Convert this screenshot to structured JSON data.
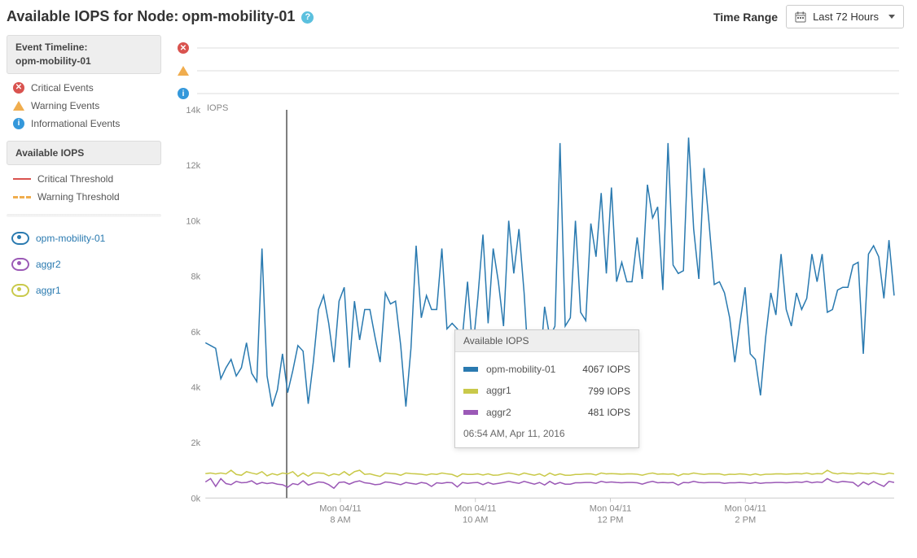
{
  "header": {
    "title_prefix": "Available IOPS for Node:",
    "node_name": "opm-mobility-01",
    "time_range_label": "Time Range",
    "time_range_value": "Last 72 Hours"
  },
  "sidebar": {
    "event_timeline_label": "Event Timeline:",
    "event_timeline_target": "opm-mobility-01",
    "events": {
      "critical": "Critical Events",
      "warning": "Warning Events",
      "info": "Informational Events"
    },
    "iops_header": "Available IOPS",
    "thresholds": {
      "critical": "Critical Threshold",
      "warning": "Warning Threshold"
    },
    "series": [
      {
        "id": "opm-mobility-01",
        "color": "#2a7ab0"
      },
      {
        "id": "aggr2",
        "color": "#9b59b6"
      },
      {
        "id": "aggr1",
        "color": "#c9c94a"
      }
    ]
  },
  "tooltip": {
    "title": "Available IOPS",
    "rows": [
      {
        "name": "opm-mobility-01",
        "value": "4067 IOPS",
        "color": "#2a7ab0"
      },
      {
        "name": "aggr1",
        "value": "799 IOPS",
        "color": "#c9c94a"
      },
      {
        "name": "aggr2",
        "value": "481 IOPS",
        "color": "#9b59b6"
      }
    ],
    "timestamp": "06:54 AM, Apr 11, 2016"
  },
  "chart_data": {
    "type": "line",
    "title": "Available IOPS for Node: opm-mobility-01",
    "ylabel": "IOPS",
    "ylim": [
      0,
      14000
    ],
    "yticks": [
      "0k",
      "2k",
      "4k",
      "6k",
      "8k",
      "10k",
      "12k",
      "14k"
    ],
    "xticks": [
      {
        "top": "Mon 04/11",
        "bottom": "8 AM",
        "frac": 0.196
      },
      {
        "top": "Mon 04/11",
        "bottom": "10 AM",
        "frac": 0.392
      },
      {
        "top": "Mon 04/11",
        "bottom": "12 PM",
        "frac": 0.588
      },
      {
        "top": "Mon 04/11",
        "bottom": "2 PM",
        "frac": 0.784
      }
    ],
    "cursor_frac": 0.118,
    "series": [
      {
        "name": "opm-mobility-01",
        "color": "#2a7ab0",
        "values": [
          5600,
          5500,
          5400,
          4300,
          4700,
          5000,
          4400,
          4700,
          5600,
          4500,
          4200,
          9000,
          4400,
          3300,
          3900,
          5200,
          3800,
          4600,
          5500,
          5300,
          3400,
          4900,
          6800,
          7300,
          6300,
          4900,
          7100,
          7600,
          4700,
          7100,
          5700,
          6800,
          6800,
          5800,
          4900,
          7400,
          7000,
          7100,
          5500,
          3300,
          5400,
          9100,
          6500,
          7300,
          6800,
          6800,
          9000,
          6100,
          6300,
          6100,
          5800,
          7800,
          5300,
          7200,
          9500,
          6300,
          9000,
          7800,
          6200,
          10000,
          8100,
          9700,
          7400,
          4400,
          5800,
          4500,
          6900,
          5800,
          6200,
          12800,
          6200,
          6500,
          10000,
          6700,
          6400,
          9900,
          8700,
          11000,
          8100,
          11200,
          7800,
          8500,
          7800,
          7800,
          9400,
          7900,
          11300,
          10100,
          10500,
          7500,
          12800,
          8400,
          8100,
          8200,
          13000,
          9700,
          7900,
          11900,
          9900,
          7700,
          7800,
          7400,
          6500,
          4900,
          6300,
          7600,
          5200,
          5000,
          3700,
          5800,
          7400,
          6600,
          8800,
          6800,
          6200,
          7400,
          6800,
          7200,
          8800,
          7800,
          8800,
          6700,
          6800,
          7500,
          7600,
          7600,
          8400,
          8500,
          5200,
          8800,
          9100,
          8700,
          7200,
          9300,
          7300
        ]
      },
      {
        "name": "aggr1",
        "color": "#c9c94a",
        "values": [
          880,
          900,
          870,
          900,
          870,
          1000,
          850,
          820,
          950,
          900,
          860,
          950,
          800,
          880,
          830,
          900,
          870,
          950,
          780,
          900,
          790,
          900,
          900,
          890,
          800,
          870,
          830,
          950,
          820,
          950,
          1000,
          850,
          870,
          820,
          780,
          900,
          880,
          870,
          820,
          900,
          880,
          870,
          860,
          830,
          870,
          850,
          900,
          870,
          850,
          770,
          870,
          850,
          850,
          870,
          830,
          870,
          820,
          830,
          870,
          900,
          870,
          830,
          900,
          860,
          820,
          870,
          790,
          900,
          820,
          870,
          820,
          820,
          850,
          850,
          870,
          870,
          830,
          900,
          870,
          880,
          870,
          860,
          870,
          870,
          860,
          820,
          870,
          900,
          860,
          870,
          860,
          870,
          800,
          870,
          860,
          900,
          870,
          850,
          870,
          870,
          870,
          830,
          860,
          850,
          870,
          860,
          830,
          870,
          830,
          860,
          860,
          870,
          870,
          860,
          870,
          880,
          870,
          900,
          860,
          880,
          870,
          1000,
          900,
          870,
          900,
          880,
          870,
          900,
          880,
          870,
          900,
          870,
          850,
          900,
          870
        ]
      },
      {
        "name": "aggr2",
        "color": "#9b59b6",
        "values": [
          580,
          700,
          420,
          700,
          520,
          480,
          600,
          550,
          560,
          620,
          500,
          560,
          520,
          550,
          500,
          480,
          390,
          520,
          480,
          620,
          470,
          520,
          580,
          560,
          480,
          350,
          560,
          580,
          500,
          580,
          620,
          550,
          530,
          480,
          500,
          580,
          560,
          520,
          480,
          560,
          530,
          500,
          560,
          530,
          420,
          550,
          530,
          560,
          550,
          400,
          560,
          530,
          550,
          560,
          480,
          560,
          500,
          530,
          560,
          600,
          560,
          530,
          600,
          550,
          500,
          560,
          470,
          600,
          500,
          560,
          500,
          500,
          550,
          550,
          560,
          560,
          530,
          600,
          560,
          580,
          560,
          550,
          560,
          560,
          550,
          500,
          560,
          600,
          550,
          560,
          550,
          560,
          470,
          560,
          550,
          600,
          560,
          550,
          560,
          560,
          560,
          530,
          550,
          550,
          560,
          550,
          530,
          560,
          530,
          550,
          550,
          560,
          560,
          550,
          560,
          580,
          560,
          600,
          550,
          580,
          560,
          700,
          600,
          560,
          600,
          580,
          560,
          420,
          580,
          480,
          600,
          500,
          420,
          600,
          560
        ]
      }
    ]
  }
}
